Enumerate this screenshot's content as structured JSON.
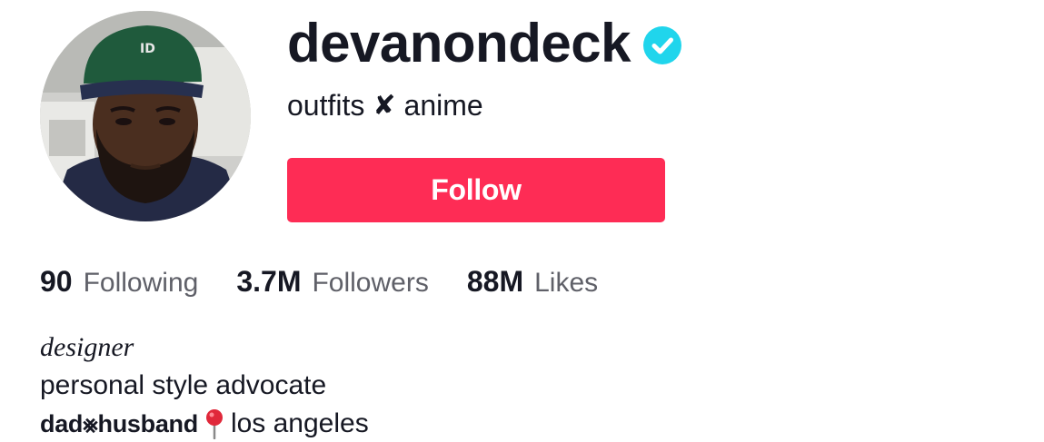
{
  "profile": {
    "username": "devanondeck",
    "verified_icon": "verified-badge-icon",
    "nickname_part1": "outfits",
    "nickname_separator": "✘",
    "nickname_part2": "anime",
    "follow_label": "Follow"
  },
  "stats": {
    "following_count": "90",
    "following_label": "Following",
    "followers_count": "3.7M",
    "followers_label": "Followers",
    "likes_count": "88M",
    "likes_label": "Likes"
  },
  "bio": {
    "line1": "designer",
    "line2": "personal style advocate",
    "line3_bold": "dad⨳husband",
    "line3_icon": "pushpin-icon",
    "line3_text": "los angeles"
  },
  "colors": {
    "accent": "#fe2c55",
    "verified": "#20d5ec",
    "text": "#161823",
    "muted": "#5f6068"
  }
}
